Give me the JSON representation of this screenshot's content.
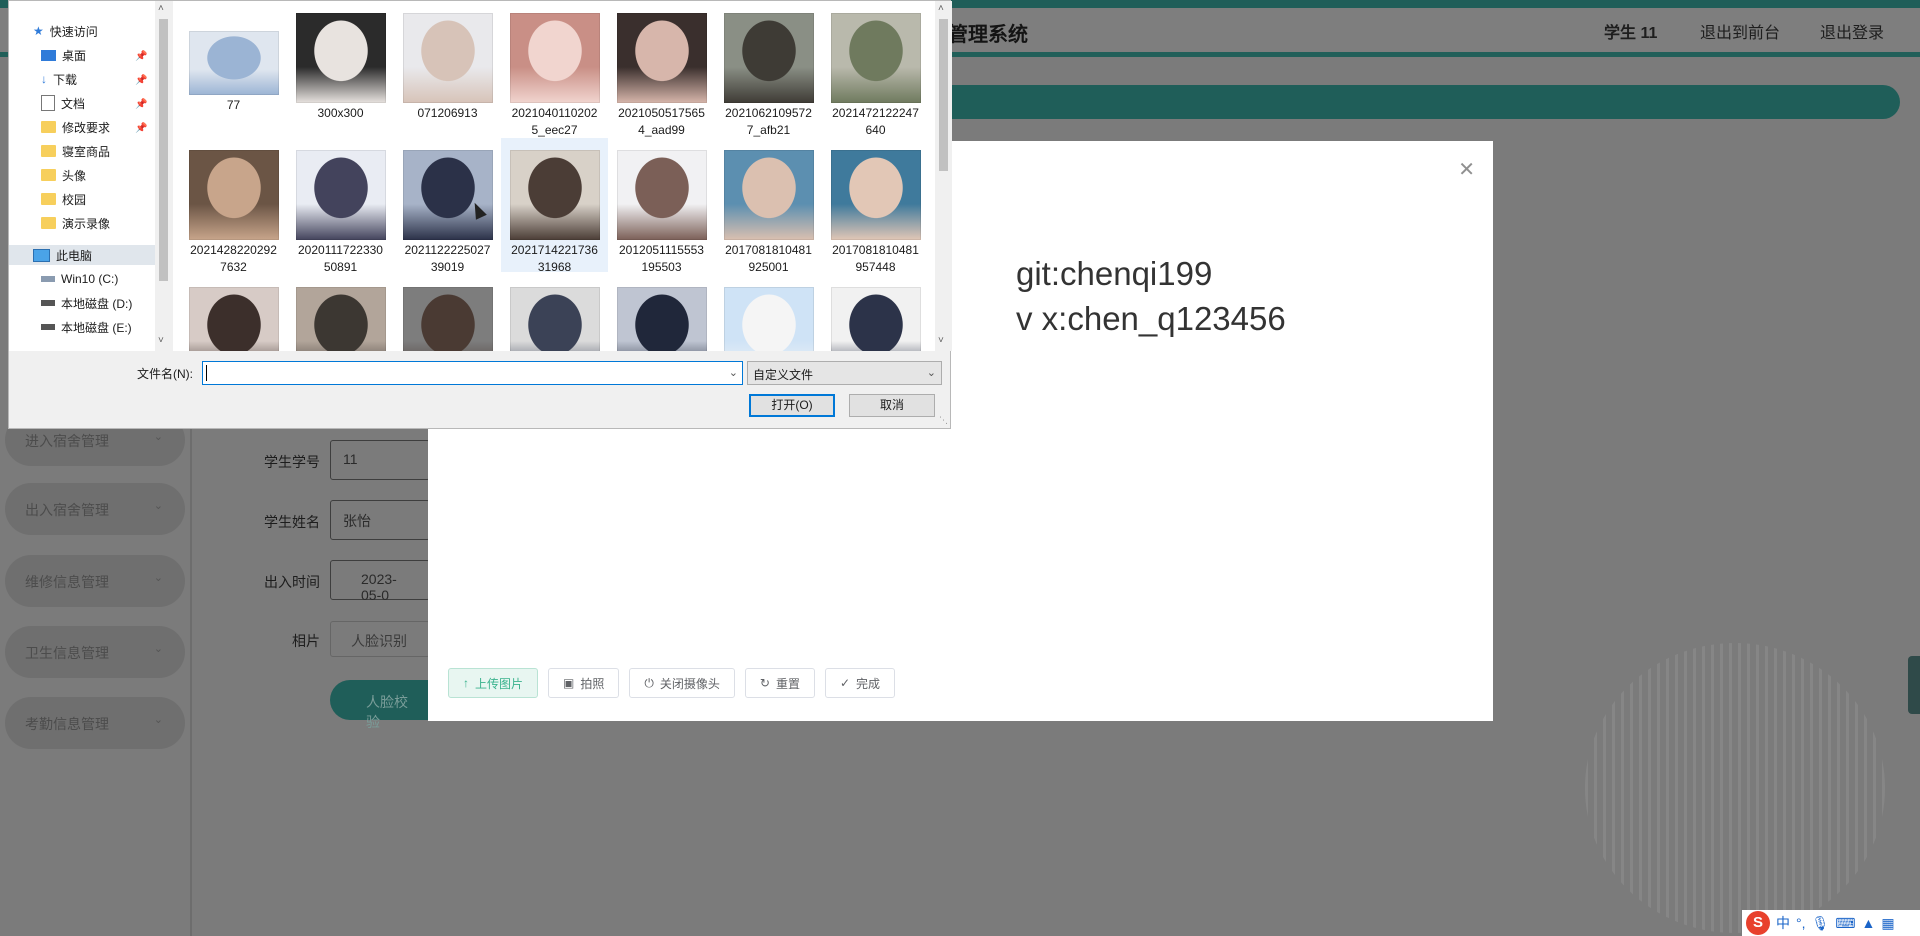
{
  "app": {
    "title": "管理系统",
    "header_links": [
      "学生 11",
      "退出到前台",
      "退出登录"
    ],
    "sidebar": [
      "进入宿舍管理",
      "出入宿舍管理",
      "维修信息管理",
      "卫生信息管理",
      "考勤信息管理"
    ],
    "form": {
      "student_id_label": "学生学号",
      "student_id_value": "11",
      "student_name_label": "学生姓名",
      "student_name_value": "张怡",
      "time_label": "出入时间",
      "time_value": "2023-05-0",
      "photo_label": "相片",
      "face_recognition": "人脸识别",
      "verify_button": "人脸校验"
    }
  },
  "modal": {
    "line1": "git:chenqi199",
    "line2": "v x:chen_q123456",
    "buttons": [
      {
        "label": "上传图片",
        "icon": "upload-icon"
      },
      {
        "label": "拍照",
        "icon": "camera-icon"
      },
      {
        "label": "关闭摄像头",
        "icon": "power-icon"
      },
      {
        "label": "重置",
        "icon": "refresh-icon"
      },
      {
        "label": "完成",
        "icon": "check-circle-icon"
      }
    ]
  },
  "dialog": {
    "nav": [
      {
        "label": "快速访问",
        "icon": "star-icon"
      },
      {
        "label": "桌面",
        "icon": "desktop-icon",
        "pinned": true
      },
      {
        "label": "下载",
        "icon": "download-icon",
        "pinned": true
      },
      {
        "label": "文档",
        "icon": "document-icon",
        "pinned": true
      },
      {
        "label": "修改要求",
        "icon": "folder-icon",
        "pinned": true
      },
      {
        "label": "寝室商品",
        "icon": "folder-icon"
      },
      {
        "label": "头像",
        "icon": "folder-icon"
      },
      {
        "label": "校园",
        "icon": "folder-icon"
      },
      {
        "label": "演示录像",
        "icon": "folder-icon"
      },
      {
        "label": "此电脑",
        "icon": "computer-icon",
        "selected": true
      },
      {
        "label": "Win10 (C:)",
        "icon": "drive-icon"
      },
      {
        "label": "本地磁盘 (D:)",
        "icon": "drive-icon"
      },
      {
        "label": "本地磁盘 (E:)",
        "icon": "drive-icon"
      }
    ],
    "files": [
      [
        "77"
      ],
      [
        "300x300"
      ],
      [
        "071206913"
      ],
      [
        "2021040110202",
        "5_eec27"
      ],
      [
        "2021050517565",
        "4_aad99"
      ],
      [
        "2021062109572",
        "7_afb21"
      ],
      [
        "2021472122247",
        "640"
      ],
      [
        "2021428220292",
        "7632"
      ],
      [
        "2020111722330",
        "50891"
      ],
      [
        "2021122225027",
        "39019"
      ],
      [
        "2021714221736",
        "31968"
      ],
      [
        "2012051115553",
        "195503"
      ],
      [
        "2017081810481",
        "925001"
      ],
      [
        "2017081810481",
        "957448"
      ],
      [
        ""
      ],
      [
        ""
      ],
      [
        ""
      ],
      [
        ""
      ],
      [
        ""
      ],
      [
        ""
      ],
      [
        ""
      ]
    ],
    "selected_file_index": 10,
    "filename_label": "文件名(N):",
    "filename_value": "",
    "filetype": "自定义文件",
    "open_button": "打开(O)",
    "cancel_button": "取消"
  },
  "ime": {
    "mode": "中"
  }
}
